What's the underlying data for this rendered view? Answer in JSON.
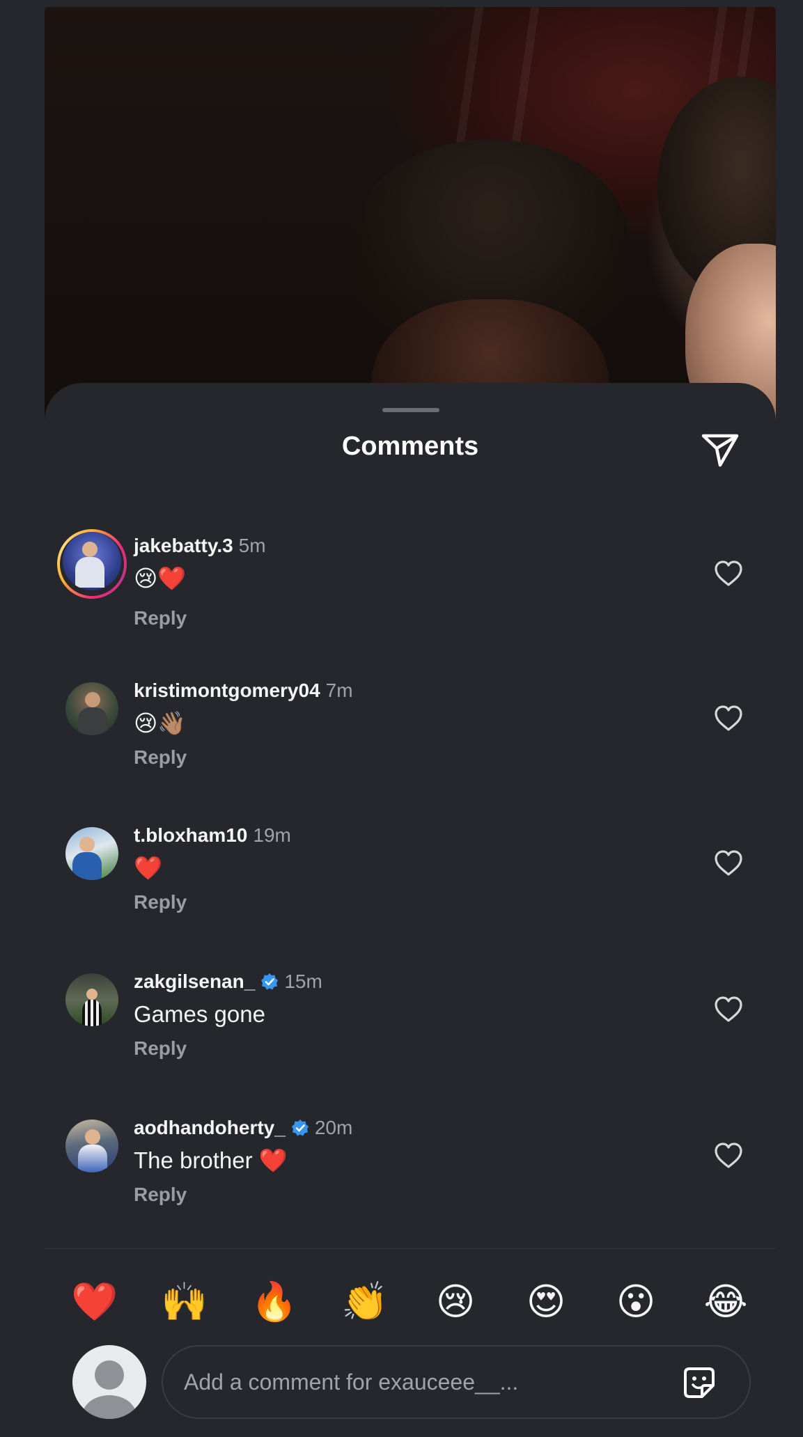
{
  "sheet": {
    "title": "Comments"
  },
  "comments": [
    {
      "username": "jakebatty.3",
      "time": "5m",
      "text": "😢❤️",
      "reply": "Reply",
      "verified": false,
      "story_ring": true
    },
    {
      "username": "kristimontgomery04",
      "time": "7m",
      "text": "😢👋🏽",
      "reply": "Reply",
      "verified": false,
      "story_ring": false
    },
    {
      "username": "t.bloxham10",
      "time": "19m",
      "text": "❤️",
      "reply": "Reply",
      "verified": false,
      "story_ring": false
    },
    {
      "username": "zakgilsenan_",
      "time": "15m",
      "text": "Games gone",
      "reply": "Reply",
      "verified": true,
      "story_ring": false
    },
    {
      "username": "aodhandoherty_",
      "time": "20m",
      "text": "The brother ❤️",
      "reply": "Reply",
      "verified": true,
      "story_ring": false
    }
  ],
  "reactions": [
    "❤️",
    "🙌",
    "🔥",
    "👏",
    "😢",
    "😍",
    "😮",
    "😂"
  ],
  "composer": {
    "placeholder": "Add a comment for exauceee__..."
  },
  "colors": {
    "background": "#25272c",
    "verified_blue": "#3797f0",
    "muted_text": "#a0a3a8"
  },
  "icons": [
    "share-icon",
    "heart-outline-icon",
    "verified-badge-icon",
    "sticker-icon",
    "default-avatar-icon"
  ]
}
